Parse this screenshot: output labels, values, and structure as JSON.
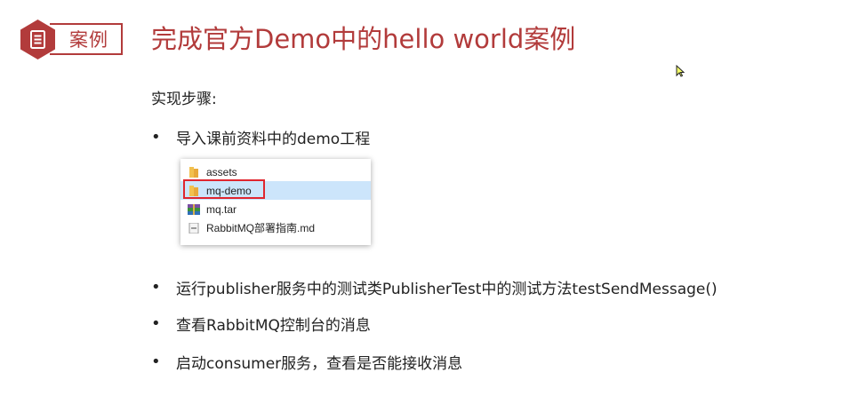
{
  "header": {
    "tag_label": "案例",
    "title": "完成官方Demo中的hello world案例"
  },
  "colors": {
    "accent": "#b23b3b",
    "highlight": "#e0262f",
    "selection": "#cce5fb"
  },
  "steps_label": "实现步骤:",
  "bullets": [
    "导入课前资料中的demo工程",
    "运行publisher服务中的测试类PublisherTest中的测试方法testSendMessage()",
    "查看RabbitMQ控制台的消息",
    "启动consumer服务，查看是否能接收消息"
  ],
  "explorer": {
    "items": [
      {
        "name": "assets",
        "icon": "folder-icon"
      },
      {
        "name": "mq-demo",
        "icon": "folder-icon",
        "selected": true
      },
      {
        "name": "mq.tar",
        "icon": "archive-icon"
      },
      {
        "name": "RabbitMQ部署指南.md",
        "icon": "markdown-file-icon"
      }
    ]
  }
}
